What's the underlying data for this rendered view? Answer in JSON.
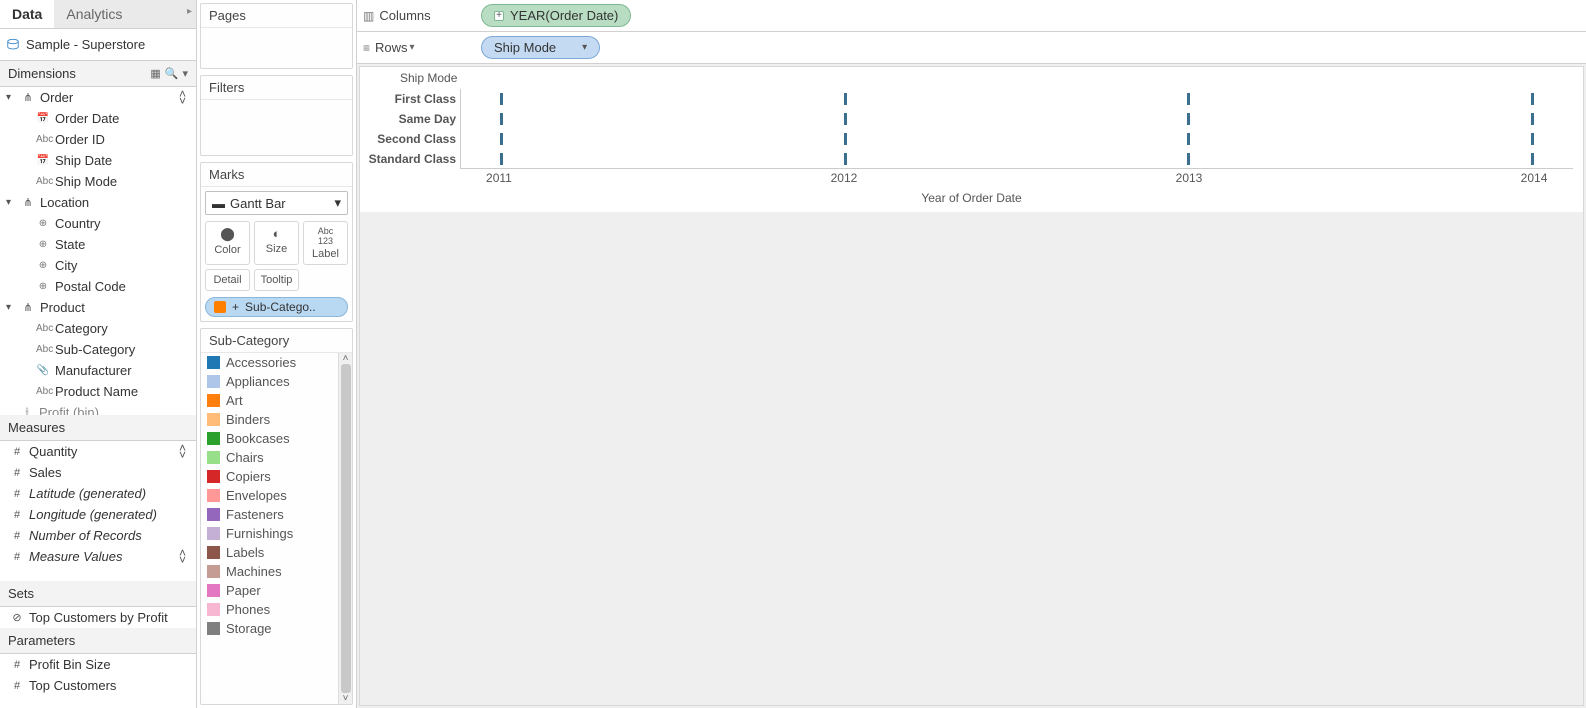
{
  "tabs": {
    "data": "Data",
    "analytics": "Analytics"
  },
  "datasource": "Sample - Superstore",
  "sections": {
    "dimensions": "Dimensions",
    "measures": "Measures",
    "sets": "Sets",
    "parameters": "Parameters"
  },
  "dim_tree": {
    "order": {
      "label": "Order",
      "children": [
        "Order Date",
        "Order ID",
        "Ship Date",
        "Ship Mode"
      ]
    },
    "location": {
      "label": "Location",
      "children": [
        "Country",
        "State",
        "City",
        "Postal Code"
      ]
    },
    "product": {
      "label": "Product",
      "children": [
        "Category",
        "Sub-Category",
        "Manufacturer",
        "Product Name"
      ]
    },
    "profit_bin": "Profit (bin)"
  },
  "dim_icons": {
    "Order Date": "date",
    "Order ID": "abc",
    "Ship Date": "date",
    "Ship Mode": "abc",
    "Country": "geo",
    "State": "geo",
    "City": "geo",
    "Postal Code": "geo",
    "Category": "abc",
    "Sub-Category": "abc",
    "Manufacturer": "clip",
    "Product Name": "abc"
  },
  "measures": [
    "Quantity",
    "Sales",
    "Latitude (generated)",
    "Longitude (generated)",
    "Number of Records",
    "Measure Values"
  ],
  "measure_italic": {
    "Latitude (generated)": true,
    "Longitude (generated)": true,
    "Number of Records": true,
    "Measure Values": true
  },
  "sets": [
    "Top Customers by Profit"
  ],
  "parameters": [
    "Profit Bin Size",
    "Top Customers"
  ],
  "shelves": {
    "pages": "Pages",
    "filters": "Filters",
    "marks": "Marks"
  },
  "marks": {
    "type": "Gantt Bar",
    "buttons": {
      "color": "Color",
      "size": "Size",
      "label": "Label",
      "detail": "Detail",
      "tooltip": "Tooltip"
    },
    "color_pill": "Sub-Catego.."
  },
  "legend": {
    "title": "Sub-Category",
    "items": [
      {
        "name": "Accessories",
        "color": "#1f77b4"
      },
      {
        "name": "Appliances",
        "color": "#aec7e8"
      },
      {
        "name": "Art",
        "color": "#ff7f0e"
      },
      {
        "name": "Binders",
        "color": "#ffbb78"
      },
      {
        "name": "Bookcases",
        "color": "#2ca02c"
      },
      {
        "name": "Chairs",
        "color": "#98df8a"
      },
      {
        "name": "Copiers",
        "color": "#d62728"
      },
      {
        "name": "Envelopes",
        "color": "#ff9896"
      },
      {
        "name": "Fasteners",
        "color": "#9467bd"
      },
      {
        "name": "Furnishings",
        "color": "#c5b0d5"
      },
      {
        "name": "Labels",
        "color": "#8c564b"
      },
      {
        "name": "Machines",
        "color": "#c49c94"
      },
      {
        "name": "Paper",
        "color": "#e377c2"
      },
      {
        "name": "Phones",
        "color": "#f7b6d2"
      },
      {
        "name": "Storage",
        "color": "#7f7f7f"
      }
    ]
  },
  "columns_rows": {
    "columns": "Columns",
    "rows": "Rows",
    "col_pill": "YEAR(Order Date)",
    "row_pill": "Ship Mode"
  },
  "chart_data": {
    "type": "gantt",
    "row_header": "Ship Mode",
    "rows": [
      "First Class",
      "Same Day",
      "Second Class",
      "Standard Class"
    ],
    "x_axis_title": "Year of Order Date",
    "x_ticks": [
      2011,
      2012,
      2013,
      2014
    ],
    "marks_at_each_year": true
  }
}
